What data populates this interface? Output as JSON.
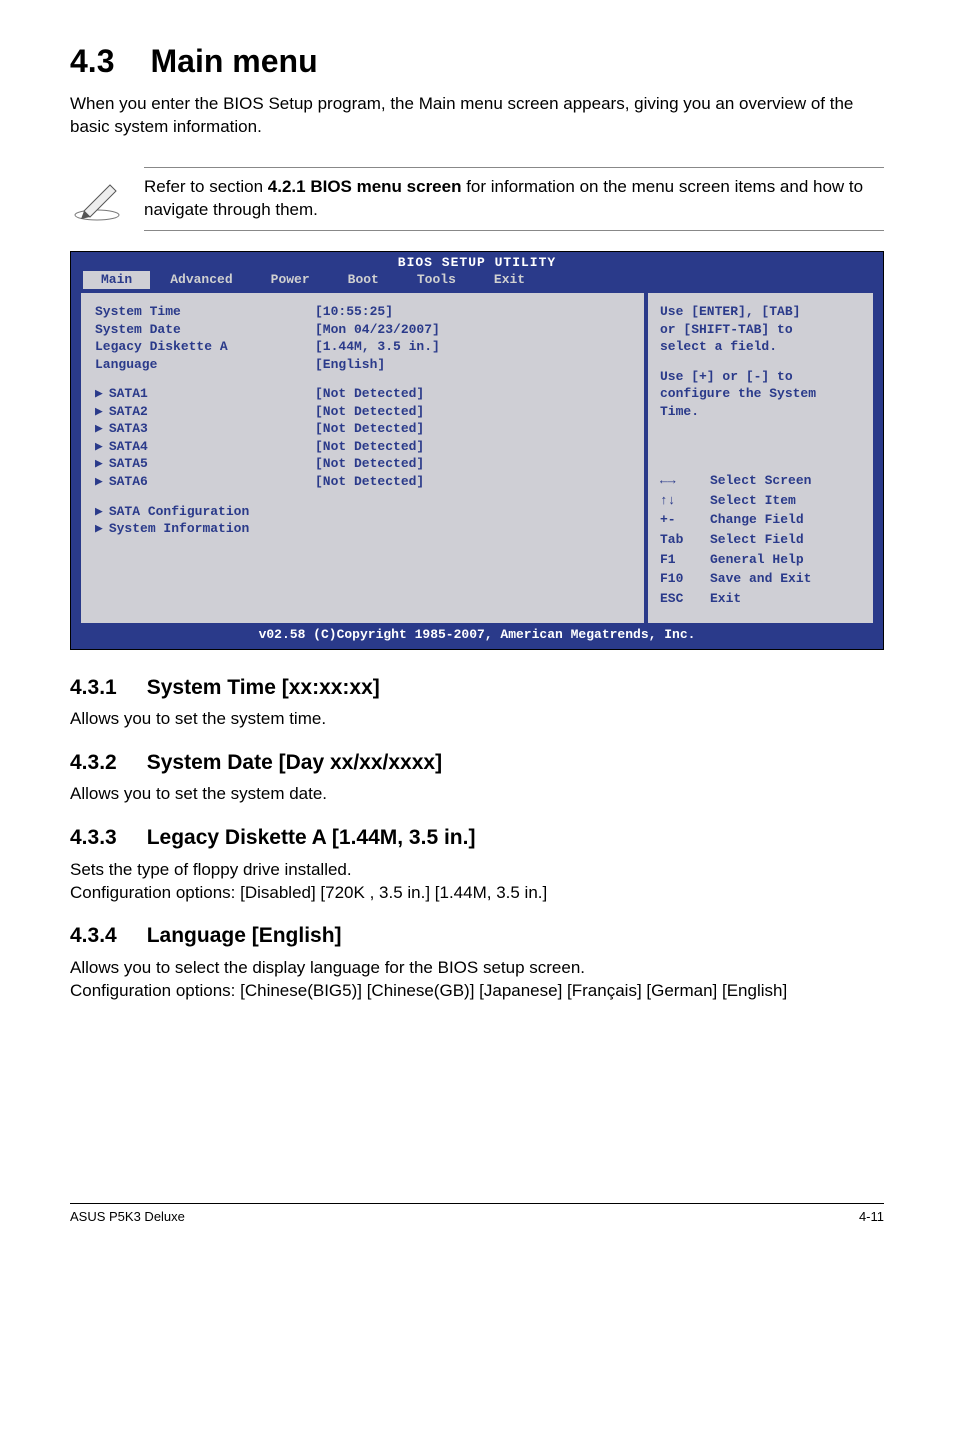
{
  "heading": {
    "num": "4.3",
    "title": "Main menu"
  },
  "intro": "When you enter the BIOS Setup program, the Main menu screen appears, giving you an overview of the basic system information.",
  "note": {
    "text_a": "Refer to section ",
    "bold": "4.2.1  BIOS menu screen",
    "text_b": " for information on the menu screen items and how to navigate through them."
  },
  "bios": {
    "title": "BIOS SETUP UTILITY",
    "tabs": [
      "Main",
      "Advanced",
      "Power",
      "Boot",
      "Tools",
      "Exit"
    ],
    "active_tab": "Main",
    "left": {
      "rows": [
        {
          "label": "System Time",
          "value": "[10:55:25]"
        },
        {
          "label": "System Date",
          "value": "[Mon 04/23/2007]"
        },
        {
          "label": "Legacy Diskette A",
          "value": "[1.44M, 3.5 in.]"
        },
        {
          "label": "Language",
          "value": "[English]"
        }
      ],
      "sata": [
        {
          "label": "SATA1",
          "value": "[Not Detected]"
        },
        {
          "label": "SATA2",
          "value": "[Not Detected]"
        },
        {
          "label": "SATA3",
          "value": "[Not Detected]"
        },
        {
          "label": "SATA4",
          "value": "[Not Detected]"
        },
        {
          "label": "SATA5",
          "value": "[Not Detected]"
        },
        {
          "label": "SATA6",
          "value": "[Not Detected]"
        }
      ],
      "extras": [
        "SATA Configuration",
        "System Information"
      ]
    },
    "right": {
      "help1": "Use [ENTER], [TAB]\nor [SHIFT-TAB] to\nselect a field.",
      "help2": "Use [+] or [-] to\nconfigure the System\nTime.",
      "nav": [
        {
          "key": "←→",
          "label": "Select Screen"
        },
        {
          "key": "↑↓",
          "label": "Select Item"
        },
        {
          "key": "+-",
          "label": "Change Field"
        },
        {
          "key": "Tab",
          "label": "Select Field"
        },
        {
          "key": "F1",
          "label": "General Help"
        },
        {
          "key": "F10",
          "label": "Save and Exit"
        },
        {
          "key": "ESC",
          "label": "Exit"
        }
      ]
    },
    "footer": "v02.58 (C)Copyright 1985-2007, American Megatrends, Inc."
  },
  "sections": {
    "s431": {
      "num": "4.3.1",
      "title": "System Time [xx:xx:xx]",
      "body": "Allows you to set the system time."
    },
    "s432": {
      "num": "4.3.2",
      "title": "System Date [Day xx/xx/xxxx]",
      "body": "Allows you to set the system date."
    },
    "s433": {
      "num": "4.3.3",
      "title": "Legacy Diskette A [1.44M, 3.5 in.]",
      "body1": "Sets the type of floppy drive installed.",
      "body2": "Configuration options: [Disabled] [720K , 3.5 in.] [1.44M, 3.5 in.]"
    },
    "s434": {
      "num": "4.3.4",
      "title": "Language [English]",
      "body1": "Allows you to select the display language for the BIOS setup screen.",
      "body2": "Configuration options: [Chinese(BIG5)] [Chinese(GB)] [Japanese] [Français] [German] [English]"
    }
  },
  "footer": {
    "left": "ASUS P5K3 Deluxe",
    "right": "4-11"
  }
}
